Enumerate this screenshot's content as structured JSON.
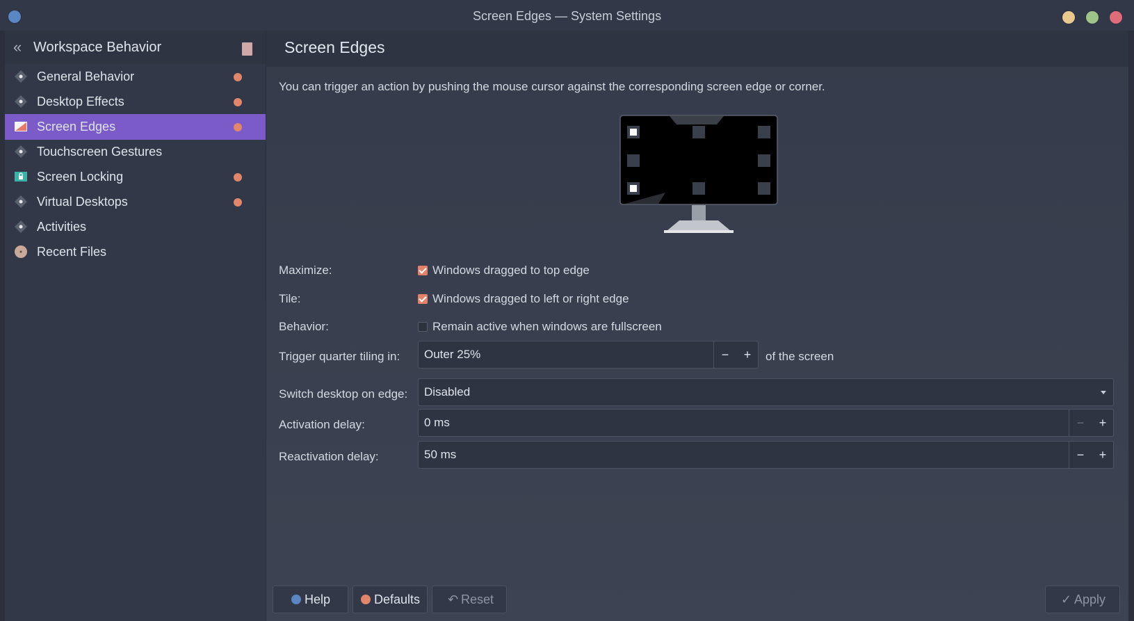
{
  "window": {
    "title": "Screen Edges — System Settings"
  },
  "sidebar": {
    "title": "Workspace Behavior",
    "items": [
      {
        "label": "General Behavior",
        "modified": true,
        "icon": "general-behavior-icon"
      },
      {
        "label": "Desktop Effects",
        "modified": true,
        "icon": "desktop-effects-icon"
      },
      {
        "label": "Screen Edges",
        "modified": true,
        "active": true,
        "icon": "screen-edges-icon"
      },
      {
        "label": "Touchscreen Gestures",
        "modified": false,
        "icon": "touchscreen-gestures-icon"
      },
      {
        "label": "Screen Locking",
        "modified": true,
        "icon": "screen-locking-icon"
      },
      {
        "label": "Virtual Desktops",
        "modified": true,
        "icon": "virtual-desktops-icon"
      },
      {
        "label": "Activities",
        "modified": false,
        "icon": "activities-icon"
      },
      {
        "label": "Recent Files",
        "modified": false,
        "icon": "recent-files-icon"
      }
    ]
  },
  "page": {
    "title": "Screen Edges",
    "description": "You can trigger an action by pushing the mouse cursor against the corresponding screen edge or corner."
  },
  "form": {
    "maximize": {
      "label": "Maximize:",
      "option": "Windows dragged to top edge",
      "checked": true
    },
    "tile": {
      "label": "Tile:",
      "option": "Windows dragged to left or right edge",
      "checked": true
    },
    "behavior": {
      "label": "Behavior:",
      "option": "Remain active when windows are fullscreen",
      "checked": false
    },
    "quarter_tiling": {
      "label": "Trigger quarter tiling in:",
      "value": "Outer 25%",
      "suffix": "of the screen"
    },
    "switch_desktop": {
      "label": "Switch desktop on edge:",
      "value": "Disabled"
    },
    "activation_delay": {
      "label": "Activation delay:",
      "value": "0 ms"
    },
    "reactivation_delay": {
      "label": "Reactivation delay:",
      "value": "50 ms"
    }
  },
  "spin": {
    "minus": "−",
    "plus": "+"
  },
  "footer": {
    "help": "Help",
    "defaults": "Defaults",
    "reset": "Reset",
    "apply": "Apply"
  },
  "colors": {
    "accent": "#7b5bc7",
    "modified_dot": "#e0866b",
    "checkbox_checked": "#e2826a"
  }
}
